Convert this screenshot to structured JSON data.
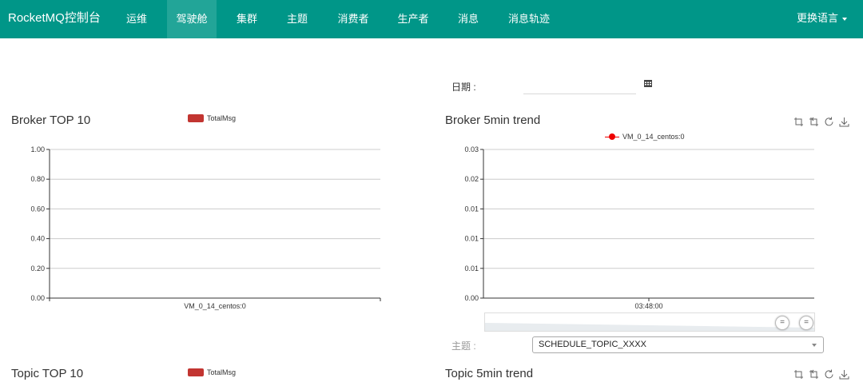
{
  "navbar": {
    "brand": "RocketMQ控制台",
    "items": [
      {
        "label": "运维"
      },
      {
        "label": "驾驶舱"
      },
      {
        "label": "集群"
      },
      {
        "label": "主题"
      },
      {
        "label": "消费者"
      },
      {
        "label": "生产者"
      },
      {
        "label": "消息"
      },
      {
        "label": "消息轨迹"
      }
    ],
    "active_item": "驾驶舱",
    "language": "更换语言"
  },
  "date_filter": {
    "label": "日期 :",
    "value": ""
  },
  "colors": {
    "navbar": "#009688",
    "navbar_active": "#22a598",
    "bar_series": "#c23531",
    "line_series": "#ee0000"
  },
  "broker_top": {
    "title": "Broker TOP 10",
    "legend": "TotalMsg"
  },
  "broker_trend": {
    "title": "Broker 5min trend",
    "legend": "VM_0_14_centos:0"
  },
  "topic_top": {
    "title": "Topic TOP 10",
    "legend": "TotalMsg"
  },
  "topic_trend": {
    "title": "Topic 5min trend"
  },
  "topic_filter": {
    "label": "主题 :",
    "selected": "SCHEDULE_TOPIC_XXXX"
  },
  "toolbox_icons": [
    "zoom-icon",
    "zoom-reset-icon",
    "refresh-icon",
    "download-icon"
  ],
  "chart_data": [
    {
      "type": "bar",
      "title": "Broker TOP 10",
      "categories": [
        "VM_0_14_centos:0"
      ],
      "series": [
        {
          "name": "TotalMsg",
          "values": [
            0
          ]
        }
      ],
      "ylim": [
        0,
        1
      ],
      "y_ticks": [
        "0.00",
        "0.20",
        "0.40",
        "0.60",
        "0.80",
        "1.00"
      ],
      "grid": true,
      "legend": "top-center"
    },
    {
      "type": "line",
      "title": "Broker 5min trend",
      "x": [
        "03:48:00"
      ],
      "series": [
        {
          "name": "VM_0_14_centos:0",
          "values": [
            0
          ]
        }
      ],
      "y_ticks": [
        "0.00",
        "0.01",
        "0.01",
        "0.01",
        "0.02",
        "0.03"
      ],
      "grid": true,
      "legend": "top-center"
    }
  ]
}
